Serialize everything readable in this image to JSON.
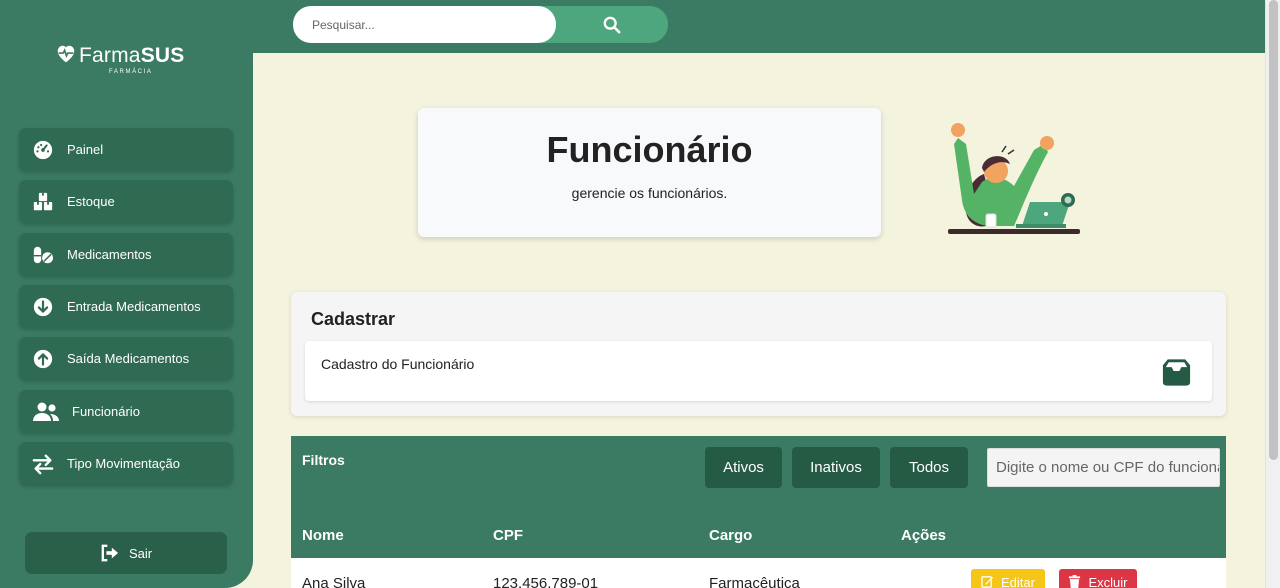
{
  "app": {
    "logo_light": "Farma",
    "logo_bold": "SUS",
    "logo_sub": "FARMÁCIA"
  },
  "search": {
    "placeholder": "Pesquisar..."
  },
  "sidebar": {
    "items": [
      {
        "label": "Painel",
        "icon": "dashboard-icon"
      },
      {
        "label": "Estoque",
        "icon": "boxes-icon"
      },
      {
        "label": "Medicamentos",
        "icon": "pills-icon"
      },
      {
        "label": "Entrada Medicamentos",
        "icon": "arrow-down-circle-icon"
      },
      {
        "label": "Saída Medicamentos",
        "icon": "arrow-up-circle-icon"
      },
      {
        "label": "Funcionário",
        "icon": "users-icon"
      },
      {
        "label": "Tipo Movimentação",
        "icon": "exchange-icon"
      }
    ],
    "logout_label": "Sair"
  },
  "hero": {
    "title": "Funcionário",
    "subtitle": "gerencie os funcionários."
  },
  "register": {
    "title": "Cadastrar",
    "item_label": "Cadastro do Funcionário"
  },
  "filters": {
    "title": "Filtros",
    "buttons": [
      "Ativos",
      "Inativos",
      "Todos"
    ],
    "input_placeholder": "Digite o nome ou CPF do funcionário"
  },
  "table": {
    "columns": [
      "Nome",
      "CPF",
      "Cargo",
      "Ações"
    ],
    "rows": [
      {
        "nome": "Ana Silva",
        "cpf": "123.456.789-01",
        "cargo": "Farmacêutica"
      }
    ],
    "edit_label": "Editar",
    "delete_label": "Excluir"
  },
  "colors": {
    "primary": "#3b7b64",
    "primary_dark": "#255a45",
    "background": "#f4f3de",
    "edit": "#f5c518",
    "delete": "#dc3545"
  }
}
